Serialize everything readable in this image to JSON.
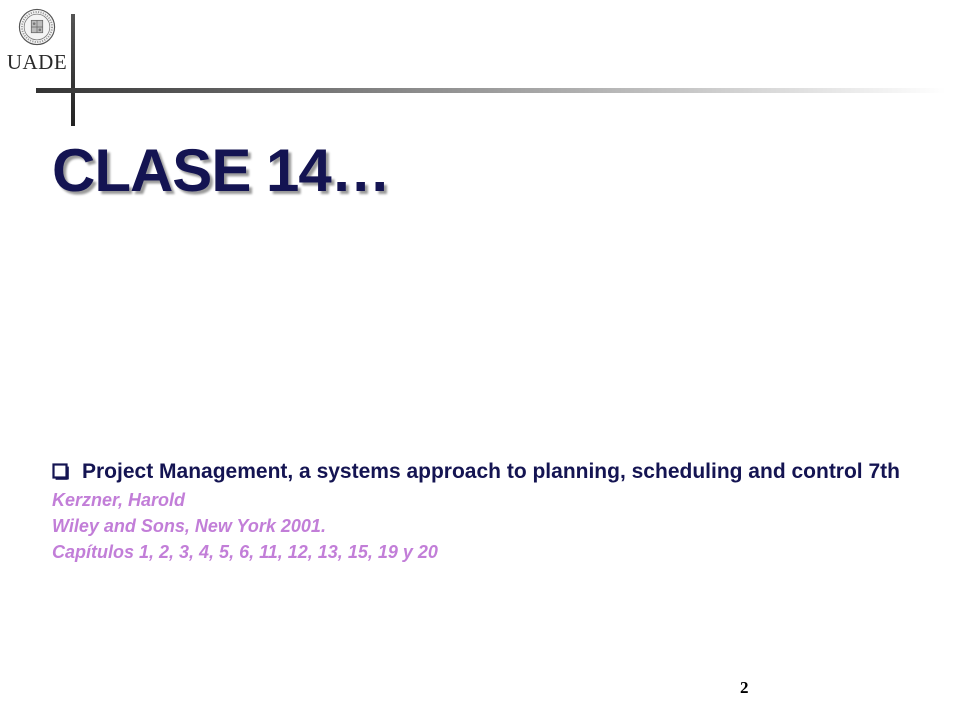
{
  "logo": {
    "text": "UADE",
    "seal_icon": "university-seal-icon"
  },
  "slide": {
    "title": "CLASE 14…",
    "reference": {
      "title": "Project Management, a systems approach to planning, scheduling and control 7th",
      "author": "Kerzner, Harold",
      "publisher": "Wiley and Sons, New York 2001.",
      "chapters": "Capítulos 1, 2, 3, 4, 5, 6, 11, 12, 13, 15, 19 y 20"
    },
    "page_number": "2"
  },
  "colors": {
    "title": "#141452",
    "citation": "#c27ed8",
    "bullet": "#141452"
  },
  "icons": {
    "bullet": "checkbox-bullet-icon"
  }
}
